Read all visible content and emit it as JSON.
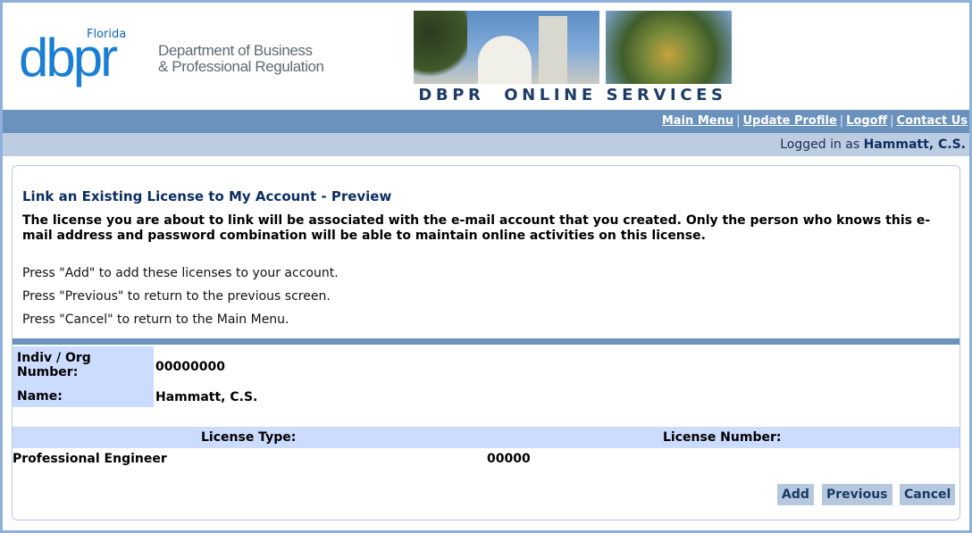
{
  "logo": {
    "state": "Florida",
    "brand": "dbpr",
    "dept_line1": "Department of Business",
    "dept_line2": "& Professional Regulation"
  },
  "banner": {
    "caption": "DBPR  ONLINE SERVICES"
  },
  "nav": {
    "items": [
      "Main Menu",
      "Update Profile",
      "Logoff",
      "Contact Us"
    ],
    "separator": "|"
  },
  "session": {
    "prefix": "Logged in as",
    "user": "Hammatt, C.S."
  },
  "page": {
    "title": "Link an Existing License to My Account - Preview",
    "notice": "The license you are about to link will be associated with the e-mail account that you created. Only the person who knows this e-mail address and password combination will be able to maintain online activities on this license.",
    "instructions": [
      "Press \"Add\" to add these licenses to your account.",
      "Press \"Previous\" to return to the previous screen.",
      "Press \"Cancel\" to return to the Main Menu."
    ]
  },
  "account": {
    "number_label": "Indiv / Org Number:",
    "number_value": "00000000",
    "name_label": "Name:",
    "name_value": "Hammatt, C.S."
  },
  "licenses": {
    "headers": [
      "License Type:",
      "License Number:"
    ],
    "rows": [
      {
        "type": "Professional Engineer",
        "number": "00000"
      }
    ]
  },
  "buttons": {
    "add": "Add",
    "previous": "Previous",
    "cancel": "Cancel"
  },
  "colors": {
    "nav_bar": "#6a92bd",
    "login_bar": "#bccde2",
    "label_bg": "#ccdcff",
    "title": "#0b2f63"
  }
}
